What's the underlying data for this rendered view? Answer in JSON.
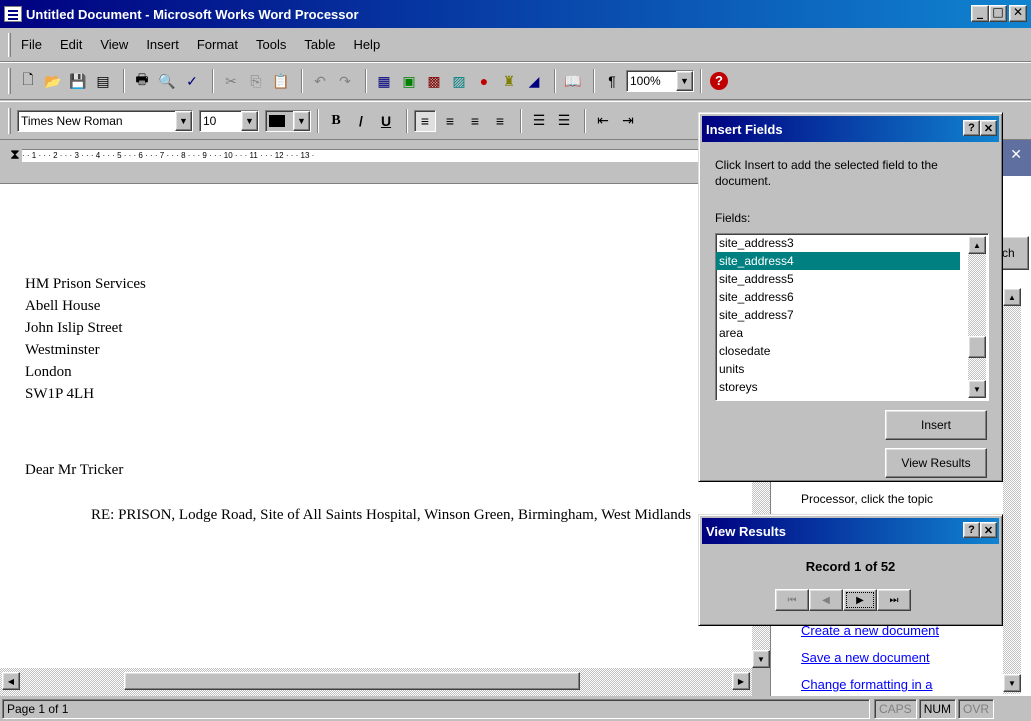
{
  "window": {
    "title": "Untitled Document - Microsoft Works Word Processor",
    "minimize": "_",
    "maximize": "□",
    "close": "✕"
  },
  "menu": [
    "File",
    "Edit",
    "View",
    "Insert",
    "Format",
    "Tools",
    "Table",
    "Help"
  ],
  "toolbar": {
    "zoom": "100%"
  },
  "format_toolbar": {
    "font": "Times New Roman",
    "size": "10",
    "bold": "B",
    "italic": "/",
    "underline": "U"
  },
  "ruler": {
    "marks": "· · 1 · · · 2 · · · 3 · · · 4 · · · 5 · · · 6 · · · 7 · · · 8 · · · 9 · · · 10 · · · 11 · · · 12 · · · 13 ·"
  },
  "document": {
    "address": [
      "HM Prison Services",
      "Abell House",
      "John Islip Street",
      "Westminster",
      "London",
      "SW1P 4LH"
    ],
    "salutation": "Dear Mr Tricker",
    "re_line": "RE: PRISON, Lodge Road, Site of All Saints Hospital, Winson Green, Birmingham, West Midlands"
  },
  "insert_fields": {
    "title": "Insert Fields",
    "help_btn": "?",
    "close_btn": "✕",
    "info": "Click Insert to add the selected field to the document.",
    "fields_label": "Fields:",
    "fields": [
      "site_address3",
      "site_address4",
      "site_address5",
      "site_address6",
      "site_address7",
      "area",
      "closedate",
      "units",
      "storeys"
    ],
    "selected": "site_address4",
    "insert_button": "Insert",
    "view_results_button": "View Results"
  },
  "view_results": {
    "title": "View Results",
    "help_btn": "?",
    "close_btn": "✕",
    "record": "Record 1 of 52",
    "first": "⏮",
    "prev": "◀",
    "next": "▶",
    "last": "⏭"
  },
  "help_panel": {
    "partial_button": "ch",
    "snippet": "Processor, click the topic",
    "links": [
      "Create a new document",
      "Save a new document",
      "Change formatting in a"
    ]
  },
  "status": {
    "page": "Page 1 of 1",
    "caps": "CAPS",
    "num": "NUM",
    "ovr": "OVR"
  }
}
